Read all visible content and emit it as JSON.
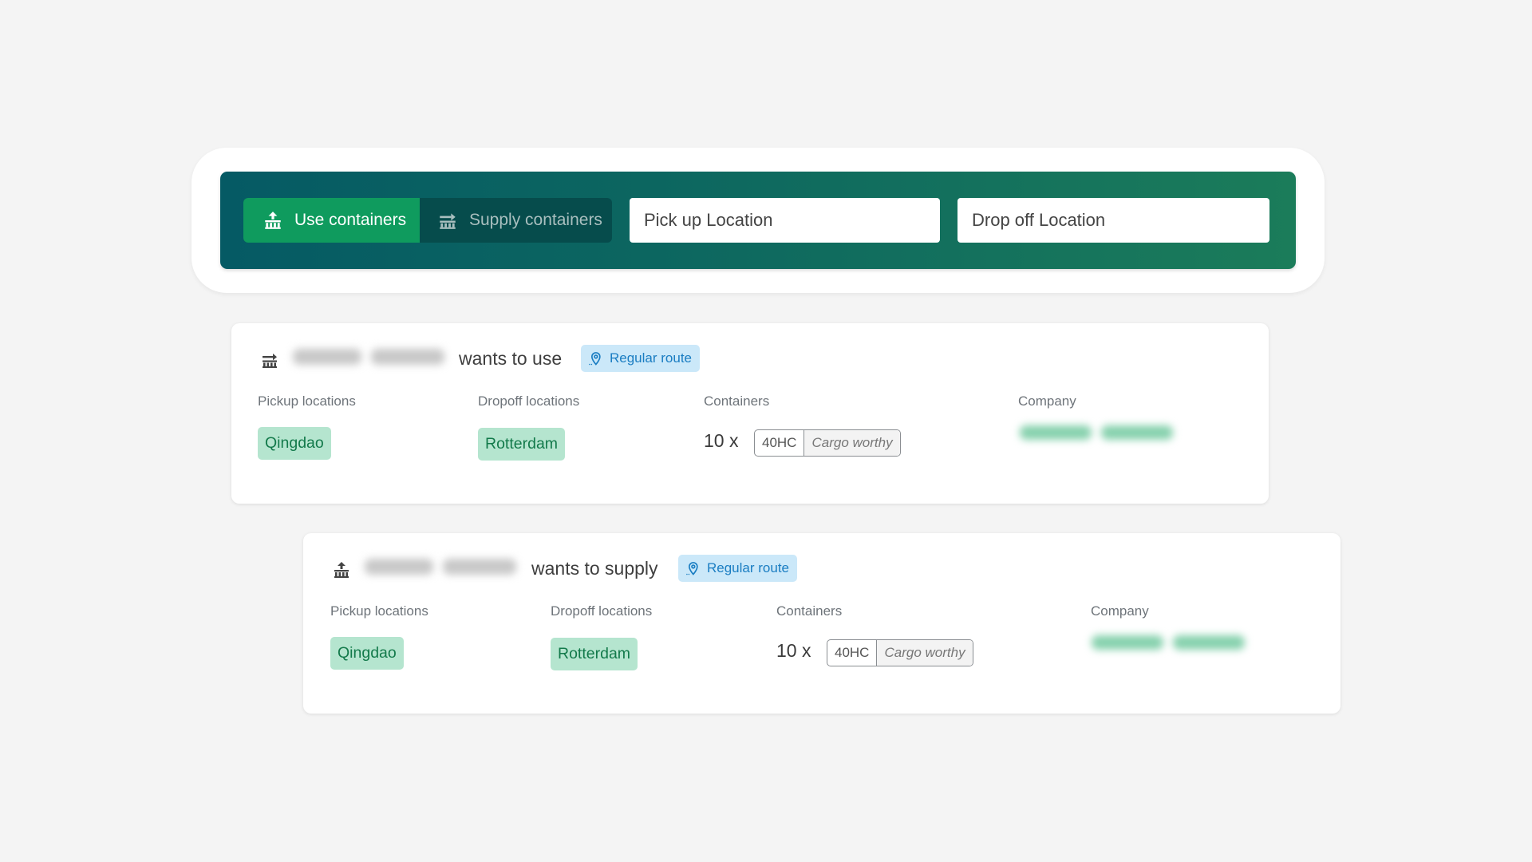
{
  "search": {
    "mode_toggle": [
      {
        "label": "Use containers",
        "icon": "container-upload-icon",
        "active": true
      },
      {
        "label": "Supply containers",
        "icon": "container-forward-icon",
        "active": false
      }
    ],
    "pickup_placeholder": "Pick up Location",
    "pickup_value": "",
    "dropoff_placeholder": "Drop off Location",
    "dropoff_value": ""
  },
  "colors": {
    "primary_green": "#0f9b5e",
    "teal_dark": "#055a64",
    "chip_bg": "#b5e5cf",
    "chip_text": "#137a4b",
    "badge_bg": "#cbe8f9",
    "badge_text": "#1a7dc2"
  },
  "listings": [
    {
      "icon": "container-forward-icon",
      "user_name": "[redacted]",
      "action_text": "wants to use",
      "badge": {
        "icon": "location-pin-icon",
        "label": "Regular route"
      },
      "labels": {
        "pickup": "Pickup locations",
        "dropoff": "Dropoff locations",
        "containers": "Containers",
        "company": "Company"
      },
      "pickup_locations": [
        "Qingdao"
      ],
      "dropoff_locations": [
        "Rotterdam"
      ],
      "containers": {
        "quantity": "10 x",
        "type": "40HC",
        "condition": "Cargo worthy"
      },
      "company": "[redacted]"
    },
    {
      "icon": "container-upload-icon",
      "user_name": "[redacted]",
      "action_text": "wants to supply",
      "badge": {
        "icon": "location-pin-icon",
        "label": "Regular route"
      },
      "labels": {
        "pickup": "Pickup locations",
        "dropoff": "Dropoff locations",
        "containers": "Containers",
        "company": "Company"
      },
      "pickup_locations": [
        "Qingdao"
      ],
      "dropoff_locations": [
        "Rotterdam"
      ],
      "containers": {
        "quantity": "10 x",
        "type": "40HC",
        "condition": "Cargo worthy"
      },
      "company": "[redacted]"
    }
  ]
}
